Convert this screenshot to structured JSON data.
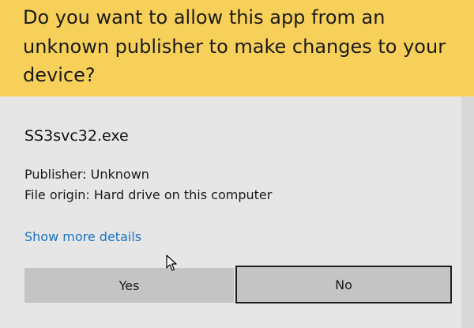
{
  "prompt": {
    "title": "Do you want to allow this app from an unknown publisher to make changes to your device?",
    "app_name": "SS3svc32.exe",
    "publisher_line": "Publisher: Unknown",
    "origin_line": "File origin: Hard drive on this computer",
    "details_link": "Show more details"
  },
  "buttons": {
    "yes_label": "Yes",
    "no_label": "No"
  },
  "colors": {
    "header_background": "#f7d05a",
    "body_background": "#e6e6e6",
    "link": "#1a73c7",
    "button_background": "#c4c4c4",
    "focused_button_border": "#202020"
  },
  "icons": {
    "cursor": "mouse-pointer-icon"
  }
}
